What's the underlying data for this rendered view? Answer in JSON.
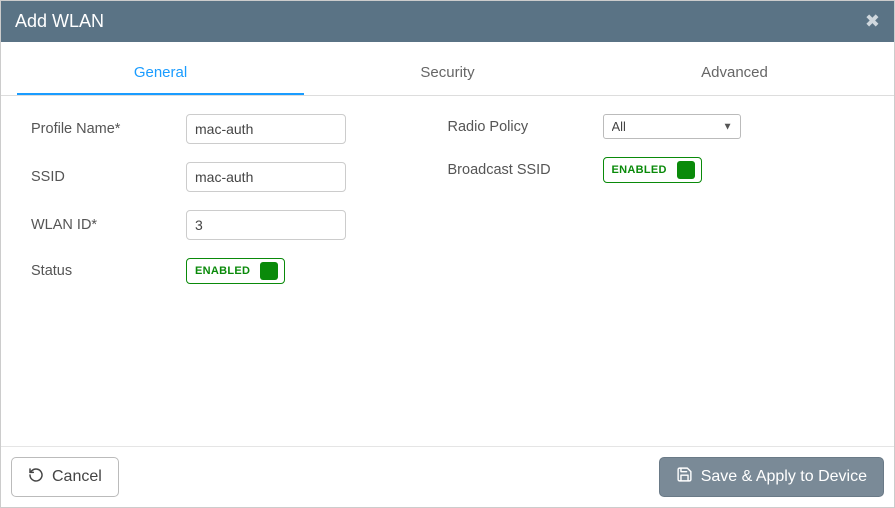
{
  "header": {
    "title": "Add WLAN"
  },
  "tabs": {
    "general": "General",
    "security": "Security",
    "advanced": "Advanced"
  },
  "form": {
    "profile_name": {
      "label": "Profile Name*",
      "value": "mac-auth"
    },
    "ssid": {
      "label": "SSID",
      "value": "mac-auth"
    },
    "wlan_id": {
      "label": "WLAN ID*",
      "value": "3"
    },
    "status": {
      "label": "Status",
      "toggle_label": "ENABLED"
    },
    "radio_policy": {
      "label": "Radio Policy",
      "value": "All"
    },
    "broadcast_ssid": {
      "label": "Broadcast SSID",
      "toggle_label": "ENABLED"
    }
  },
  "footer": {
    "cancel": "Cancel",
    "save": "Save & Apply to Device"
  }
}
